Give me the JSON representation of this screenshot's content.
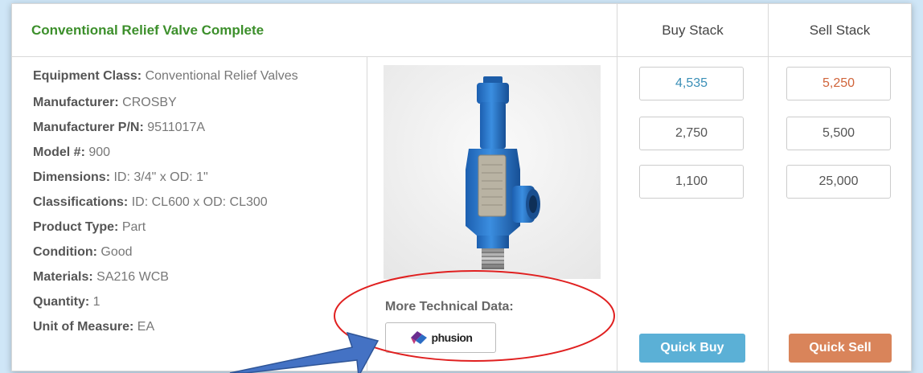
{
  "header": {
    "title": "Conventional Relief Valve Complete",
    "buy_stack": "Buy Stack",
    "sell_stack": "Sell Stack"
  },
  "specs": [
    {
      "label": "Equipment Class:",
      "value": "Conventional Relief Valves"
    },
    {
      "label": "Manufacturer:",
      "value": "CROSBY"
    },
    {
      "label": "Manufacturer P/N:",
      "value": "9511017A"
    },
    {
      "label": "Model #:",
      "value": "900"
    },
    {
      "label": "Dimensions:",
      "value": "ID: 3/4\" x OD: 1\""
    },
    {
      "label": "Classifications:",
      "value": "ID: CL600 x OD: CL300"
    },
    {
      "label": "Product Type:",
      "value": "Part"
    },
    {
      "label": "Condition:",
      "value": "Good"
    },
    {
      "label": "Materials:",
      "value": "SA216 WCB"
    },
    {
      "label": "Quantity:",
      "value": "1"
    },
    {
      "label": "Unit of Measure:",
      "value": "EA"
    }
  ],
  "technical": {
    "label": "More Technical Data:",
    "button_text": "phusion"
  },
  "buy_stack": [
    "4,535",
    "2,750",
    "1,100"
  ],
  "sell_stack": [
    "5,250",
    "5,500",
    "25,000"
  ],
  "buttons": {
    "quick_buy": "Quick Buy",
    "quick_sell": "Quick Sell"
  },
  "colors": {
    "title_green": "#3c8f2b",
    "buy_highlight": "#3a8fb7",
    "sell_highlight": "#d0643a",
    "quick_buy_bg": "#5bb0d6",
    "quick_sell_bg": "#d9845a",
    "annotation_red": "#e02020",
    "annotation_arrow": "#4472c4"
  }
}
